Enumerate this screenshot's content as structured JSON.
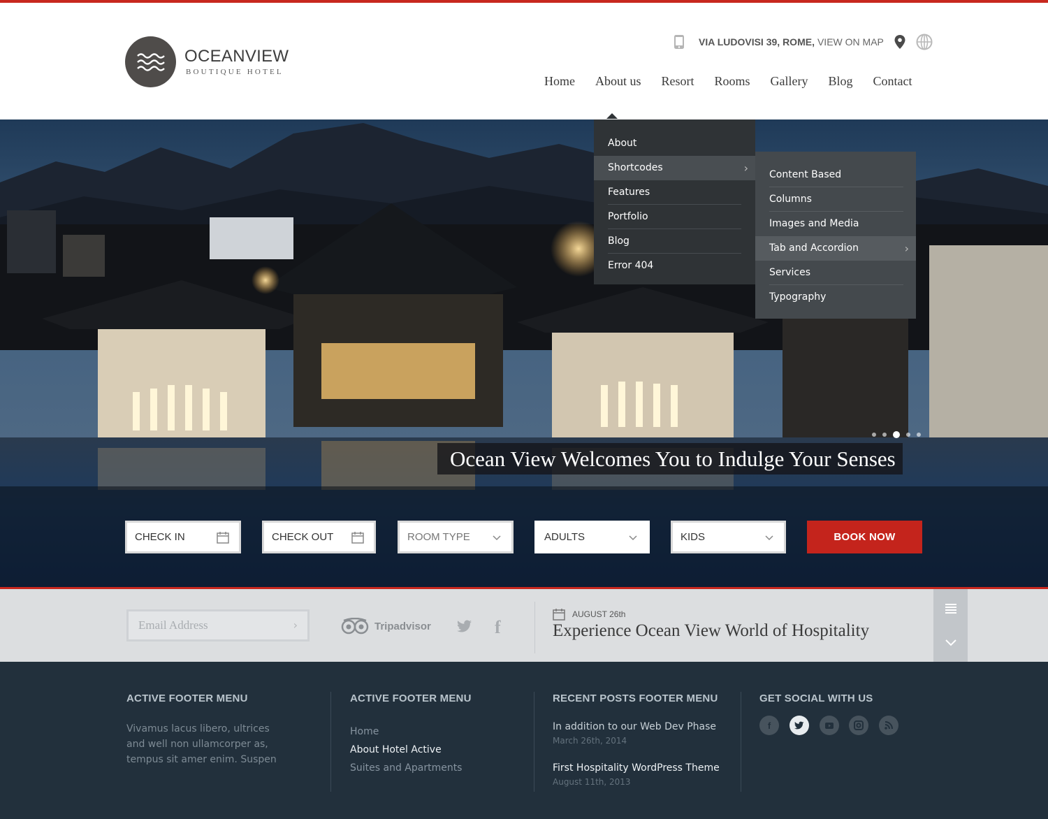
{
  "brand": {
    "name": "OCEANVIEW",
    "tagline": "BOUTIQUE HOTEL"
  },
  "contact": {
    "address": "VIA LUDOVISI 39, ROME,",
    "map_link": "VIEW ON MAP"
  },
  "nav": {
    "items": [
      "Home",
      "About us",
      "Resort",
      "Rooms",
      "Gallery",
      "Blog",
      "Contact"
    ],
    "active": "About us"
  },
  "menu_about": {
    "items": [
      "About",
      "Shortcodes",
      "Features",
      "Portfolio",
      "Blog",
      "Error 404"
    ],
    "highlighted": "Shortcodes"
  },
  "menu_shortcodes": {
    "items": [
      "Content Based",
      "Columns",
      "Images and Media",
      "Tab and Accordion",
      "Services",
      "Typography"
    ],
    "highlighted": "Tab and Accordion"
  },
  "hero": {
    "caption": "Ocean View Welcomes You to Indulge Your Senses",
    "slide_count": 5,
    "active_slide": 3
  },
  "booking": {
    "check_in": "CHECK IN",
    "check_out": "CHECK OUT",
    "room_type": "ROOM TYPE",
    "adults": "ADULTS",
    "kids": "KIDS",
    "book_button": "BOOK NOW"
  },
  "strip": {
    "email_placeholder": "Email Address",
    "tripadvisor": "Tripadvisor",
    "news_date": "AUGUST 26th",
    "news_title": "Experience Ocean View World of Hospitality"
  },
  "footer": {
    "col1": {
      "heading": "ACTIVE FOOTER MENU",
      "text_lines": [
        "Vivamus lacus libero, ultrices",
        "and well non ullamcorper as,",
        "tempus sit amer enim. Suspen"
      ]
    },
    "col2": {
      "heading": "ACTIVE FOOTER MENU",
      "links": [
        "Home",
        "About Hotel Active",
        "Suites and Apartments"
      ],
      "active": "About Hotel Active"
    },
    "col3": {
      "heading": "RECENT POSTS FOOTER MENU",
      "posts": [
        {
          "title": "In addition to our Web Dev Phase",
          "date": "March 26th, 2014"
        },
        {
          "title": "First Hospitality WordPress Theme",
          "date": "August 11th, 2013"
        }
      ]
    },
    "col4": {
      "heading": "GET SOCIAL WITH US",
      "icons": [
        "facebook-icon",
        "twitter-icon",
        "youtube-icon",
        "instagram-icon",
        "rss-icon"
      ],
      "active": "twitter-icon"
    }
  },
  "colors": {
    "accent": "#c8281e",
    "book_button": "#c4241c",
    "footer_bg": "#22303c",
    "strip_bg": "#dcdee0",
    "menu_bg": "#2f3336",
    "submenu_bg": "#44494d"
  }
}
